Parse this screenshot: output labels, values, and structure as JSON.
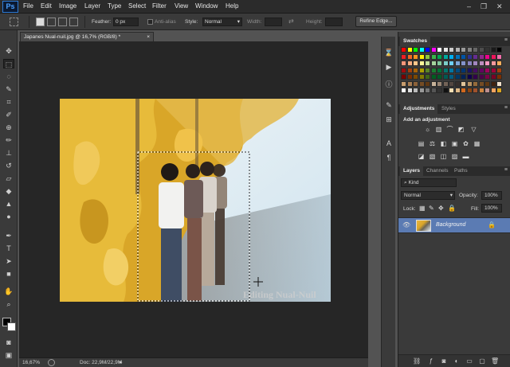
{
  "app": {
    "logo": "Ps"
  },
  "menu": [
    "File",
    "Edit",
    "Image",
    "Layer",
    "Type",
    "Select",
    "Filter",
    "View",
    "Window",
    "Help"
  ],
  "window_controls": {
    "minimize": "–",
    "restore": "❐",
    "close": "✕"
  },
  "options_bar": {
    "feather_label": "Feather:",
    "feather_value": "0 px",
    "antialias_label": "Anti-alias",
    "style_label": "Style:",
    "style_value": "Normal",
    "width_label": "Width:",
    "height_label": "Height:",
    "refine_edge_label": "Refine Edge..."
  },
  "document": {
    "tab_title": "Japanes Nual-nuil.jpg @ 16,7% (RGB/8) *",
    "close_glyph": "×",
    "watermark": "Editing Nual-Nuil"
  },
  "status": {
    "zoom": "16,67%",
    "doc_info": "Doc: 22,9M/22,9M"
  },
  "panels": {
    "swatches_tab": "Swatches",
    "adjustments_tab": "Adjustments",
    "styles_tab": "Styles",
    "add_adjustment": "Add an adjustment",
    "layers_tab": "Layers",
    "channels_tab": "Channels",
    "paths_tab": "Paths",
    "kind_value": "Kind",
    "blend_mode": "Normal",
    "opacity_label": "Opacity:",
    "opacity_value": "100%",
    "lock_label": "Lock:",
    "fill_label": "Fill:",
    "fill_value": "100%",
    "layer_name": "Background",
    "menu_glyph": "≡"
  },
  "colors": {
    "accent": "#2e7bd6",
    "layer_selected": "#5b7bb3",
    "canvas_bg": "#262626",
    "panel_bg": "#3a3a3a"
  }
}
